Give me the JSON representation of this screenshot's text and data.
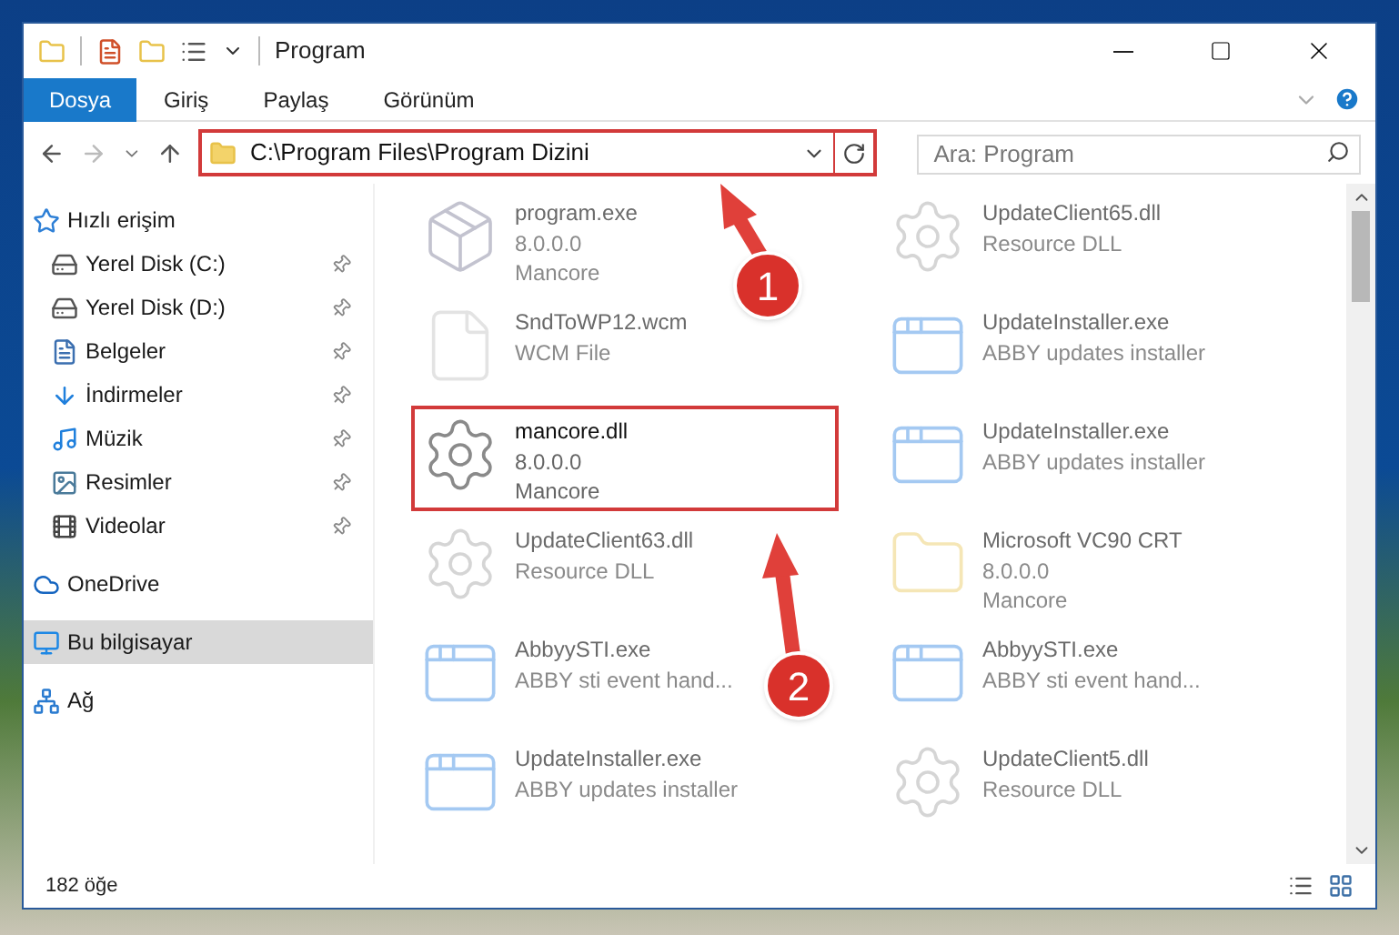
{
  "window": {
    "title": "Program"
  },
  "ribbon_tabs": [
    {
      "label": "Dosya",
      "kind": "file"
    },
    {
      "label": "Giriş",
      "kind": "tab"
    },
    {
      "label": "Paylaş",
      "kind": "tab"
    },
    {
      "label": "Görünüm",
      "kind": "tab"
    }
  ],
  "address": {
    "path": "C:\\Program Files\\Program Dizini",
    "highlighted": true
  },
  "search": {
    "placeholder": "Ara: Program"
  },
  "nav": [
    {
      "label": "Hızlı erişim",
      "pinned": false,
      "selected": false,
      "children": [
        {
          "label": "Yerel Disk (C:)",
          "pinned": true,
          "selected": false
        },
        {
          "label": "Yerel Disk (D:)",
          "pinned": true,
          "selected": false
        },
        {
          "label": "Belgeler",
          "pinned": true,
          "selected": false
        },
        {
          "label": "İndirmeler",
          "pinned": true,
          "selected": false
        },
        {
          "label": "Müzik",
          "pinned": true,
          "selected": false
        },
        {
          "label": "Resimler",
          "pinned": true,
          "selected": false
        },
        {
          "label": "Videolar",
          "pinned": true,
          "selected": false
        }
      ]
    },
    {
      "label": "OneDrive",
      "pinned": false,
      "selected": false
    },
    {
      "label": "Bu bilgisayar",
      "pinned": false,
      "selected": true
    },
    {
      "label": "Ağ",
      "pinned": false,
      "selected": false
    }
  ],
  "files": [
    {
      "name": "program.exe",
      "lines": [
        "8.0.0.0",
        "Mancore"
      ],
      "faded": true,
      "highlighted": false
    },
    {
      "name": "UpdateClient65.dll",
      "lines": [
        "Resource DLL"
      ],
      "faded": true,
      "highlighted": false
    },
    {
      "name": "SndToWP12.wcm",
      "lines": [
        "WCM File"
      ],
      "faded": true,
      "highlighted": false
    },
    {
      "name": "UpdateInstaller.exe",
      "lines": [
        "ABBY updates installer"
      ],
      "faded": true,
      "highlighted": false
    },
    {
      "name": "mancore.dll",
      "lines": [
        "8.0.0.0",
        "Mancore"
      ],
      "faded": false,
      "highlighted": true
    },
    {
      "name": "UpdateInstaller.exe",
      "lines": [
        "ABBY updates installer"
      ],
      "faded": true,
      "highlighted": false
    },
    {
      "name": "UpdateClient63.dll",
      "lines": [
        "Resource DLL"
      ],
      "faded": true,
      "highlighted": false
    },
    {
      "name": "Microsoft VC90 CRT",
      "lines": [
        "8.0.0.0",
        "Mancore"
      ],
      "faded": true,
      "highlighted": false
    },
    {
      "name": "AbbyySTI.exe",
      "lines": [
        "ABBY sti event hand..."
      ],
      "faded": true,
      "highlighted": false
    },
    {
      "name": "AbbyySTI.exe",
      "lines": [
        "ABBY sti event hand..."
      ],
      "faded": true,
      "highlighted": false
    },
    {
      "name": "UpdateInstaller.exe",
      "lines": [
        "ABBY updates installer"
      ],
      "faded": true,
      "highlighted": false
    },
    {
      "name": "UpdateClient5.dll",
      "lines": [
        "Resource DLL"
      ],
      "faded": true,
      "highlighted": false
    }
  ],
  "status_bar": {
    "count": "182 öğe"
  },
  "annotations": [
    {
      "number": "1"
    },
    {
      "number": "2"
    }
  ]
}
